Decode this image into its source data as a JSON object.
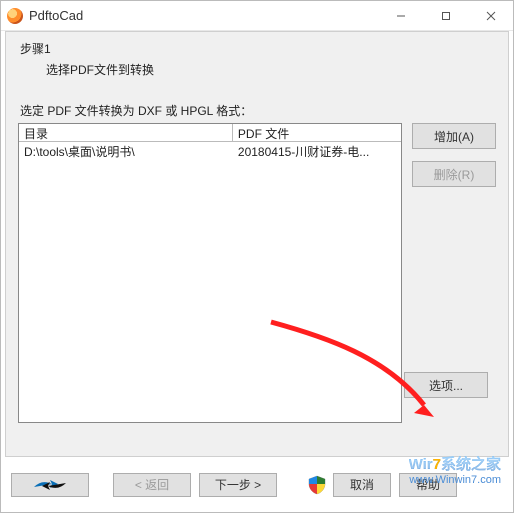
{
  "window": {
    "title": "PdftoCad"
  },
  "wizard": {
    "step_title": "步骤1",
    "step_instruction": "选择PDF文件到转换"
  },
  "content": {
    "select_label": "选定 PDF 文件转换为 DXF 或 HPGL 格式：",
    "columns": {
      "dir": "目录",
      "file": "PDF 文件"
    },
    "rows": [
      {
        "dir": "D:\\tools\\桌面\\说明书\\",
        "file": "20180415-川财证券-电..."
      }
    ]
  },
  "buttons": {
    "add": "增加(A)",
    "delete": "删除(R)",
    "options": "选项...",
    "back": "< 返回",
    "next": "下一步 >",
    "cancel": "取消",
    "help": "帮助"
  },
  "watermark": {
    "brand_prefix": "Wir",
    "brand_seven": "7",
    "brand_suffix": "系统之家",
    "url": "www.Winwin7.com"
  }
}
